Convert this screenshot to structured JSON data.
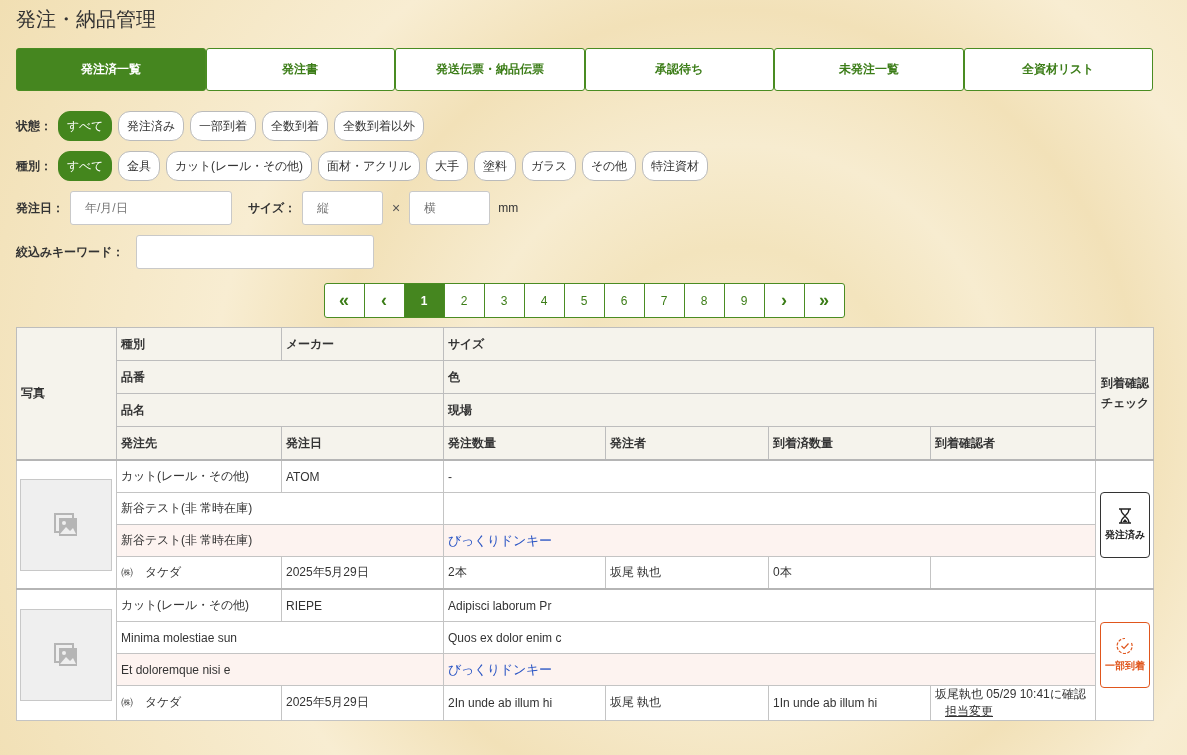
{
  "title": "発注・納品管理",
  "tabs": [
    {
      "label": "発注済一覧",
      "selected": true
    },
    {
      "label": "発注書",
      "selected": false
    },
    {
      "label": "発送伝票・納品伝票",
      "selected": false
    },
    {
      "label": "承認待ち",
      "selected": false
    },
    {
      "label": "未発注一覧",
      "selected": false
    },
    {
      "label": "全資材リスト",
      "selected": false
    }
  ],
  "filters": [
    {
      "label": "状態：",
      "options": [
        {
          "label": "すべて",
          "selected": true
        },
        {
          "label": "発注済み",
          "selected": false
        },
        {
          "label": "一部到着",
          "selected": false
        },
        {
          "label": "全数到着",
          "selected": false
        },
        {
          "label": "全数到着以外",
          "selected": false
        }
      ]
    },
    {
      "label": "種別：",
      "options": [
        {
          "label": "すべて",
          "selected": true
        },
        {
          "label": "金具",
          "selected": false
        },
        {
          "label": "カット(レール・その他)",
          "selected": false
        },
        {
          "label": "面材・アクリル",
          "selected": false
        },
        {
          "label": "大手",
          "selected": false
        },
        {
          "label": "塗料",
          "selected": false
        },
        {
          "label": "ガラス",
          "selected": false
        },
        {
          "label": "その他",
          "selected": false
        },
        {
          "label": "特注資材",
          "selected": false
        }
      ]
    }
  ],
  "order_date": {
    "label": "発注日：",
    "placeholder": "年/月/日"
  },
  "size": {
    "label": "サイズ：",
    "height": {
      "placeholder": "縦"
    },
    "times": "×",
    "width": {
      "placeholder": "横"
    },
    "unit": "mm"
  },
  "keyword": {
    "label": "絞込みキーワード："
  },
  "pagination": [
    {
      "label": "«",
      "kind": "nav",
      "selected": false
    },
    {
      "label": "‹",
      "kind": "nav",
      "selected": false
    },
    {
      "label": "1",
      "kind": "page",
      "selected": true
    },
    {
      "label": "2",
      "kind": "page",
      "selected": false
    },
    {
      "label": "3",
      "kind": "page",
      "selected": false
    },
    {
      "label": "4",
      "kind": "page",
      "selected": false
    },
    {
      "label": "5",
      "kind": "page",
      "selected": false
    },
    {
      "label": "6",
      "kind": "page",
      "selected": false
    },
    {
      "label": "7",
      "kind": "page",
      "selected": false
    },
    {
      "label": "8",
      "kind": "page",
      "selected": false
    },
    {
      "label": "9",
      "kind": "page",
      "selected": false
    },
    {
      "label": "›",
      "kind": "nav",
      "selected": false
    },
    {
      "label": "»",
      "kind": "nav",
      "selected": false
    }
  ],
  "header": {
    "photo": "写真",
    "kind": "種別",
    "maker": "メーカー",
    "size": "サイズ",
    "part_no": "品番",
    "finish": "色",
    "name": "品名",
    "site": "現場",
    "supplier": "発注先",
    "date": "発注日",
    "qty": "発注数量",
    "orderer": "発注者",
    "arrived_qty": "到着済数量",
    "confirmer": "到着確認者",
    "check": "到着確認チェック"
  },
  "rows": [
    {
      "kind": "カット(レール・その他)",
      "maker": "ATOM",
      "size": "-",
      "part_no": "新谷テスト(非 常時在庫)",
      "name": "新谷テスト(非 常時在庫)",
      "site": "びっくりドンキー",
      "supplier": "㈱　タケダ",
      "date": "2025年5月29日",
      "qty": "2本",
      "orderer": "坂尾 執也",
      "arrived_qty": "0本",
      "status": {
        "kind": "ordered",
        "label": "発注済み"
      }
    },
    {
      "kind": "カット(レール・その他)",
      "maker": "RIEPE",
      "size": "Adipisci laborum Pr",
      "part_no": "Minima molestiae sun",
      "finish": "Quos ex dolor enim c",
      "name": "Et doloremque nisi e",
      "site": "びっくりドンキー",
      "supplier": "㈱　タケダ",
      "date": "2025年5月29日",
      "qty": "2In unde ab illum hi",
      "orderer": "坂尾 執也",
      "arrived_qty": "1In unde ab illum hi",
      "confirmer": {
        "text": "坂尾執也 05/29 10:41に確認",
        "link": "担当変更"
      },
      "status": {
        "kind": "partial",
        "label": "一部到着"
      }
    }
  ]
}
